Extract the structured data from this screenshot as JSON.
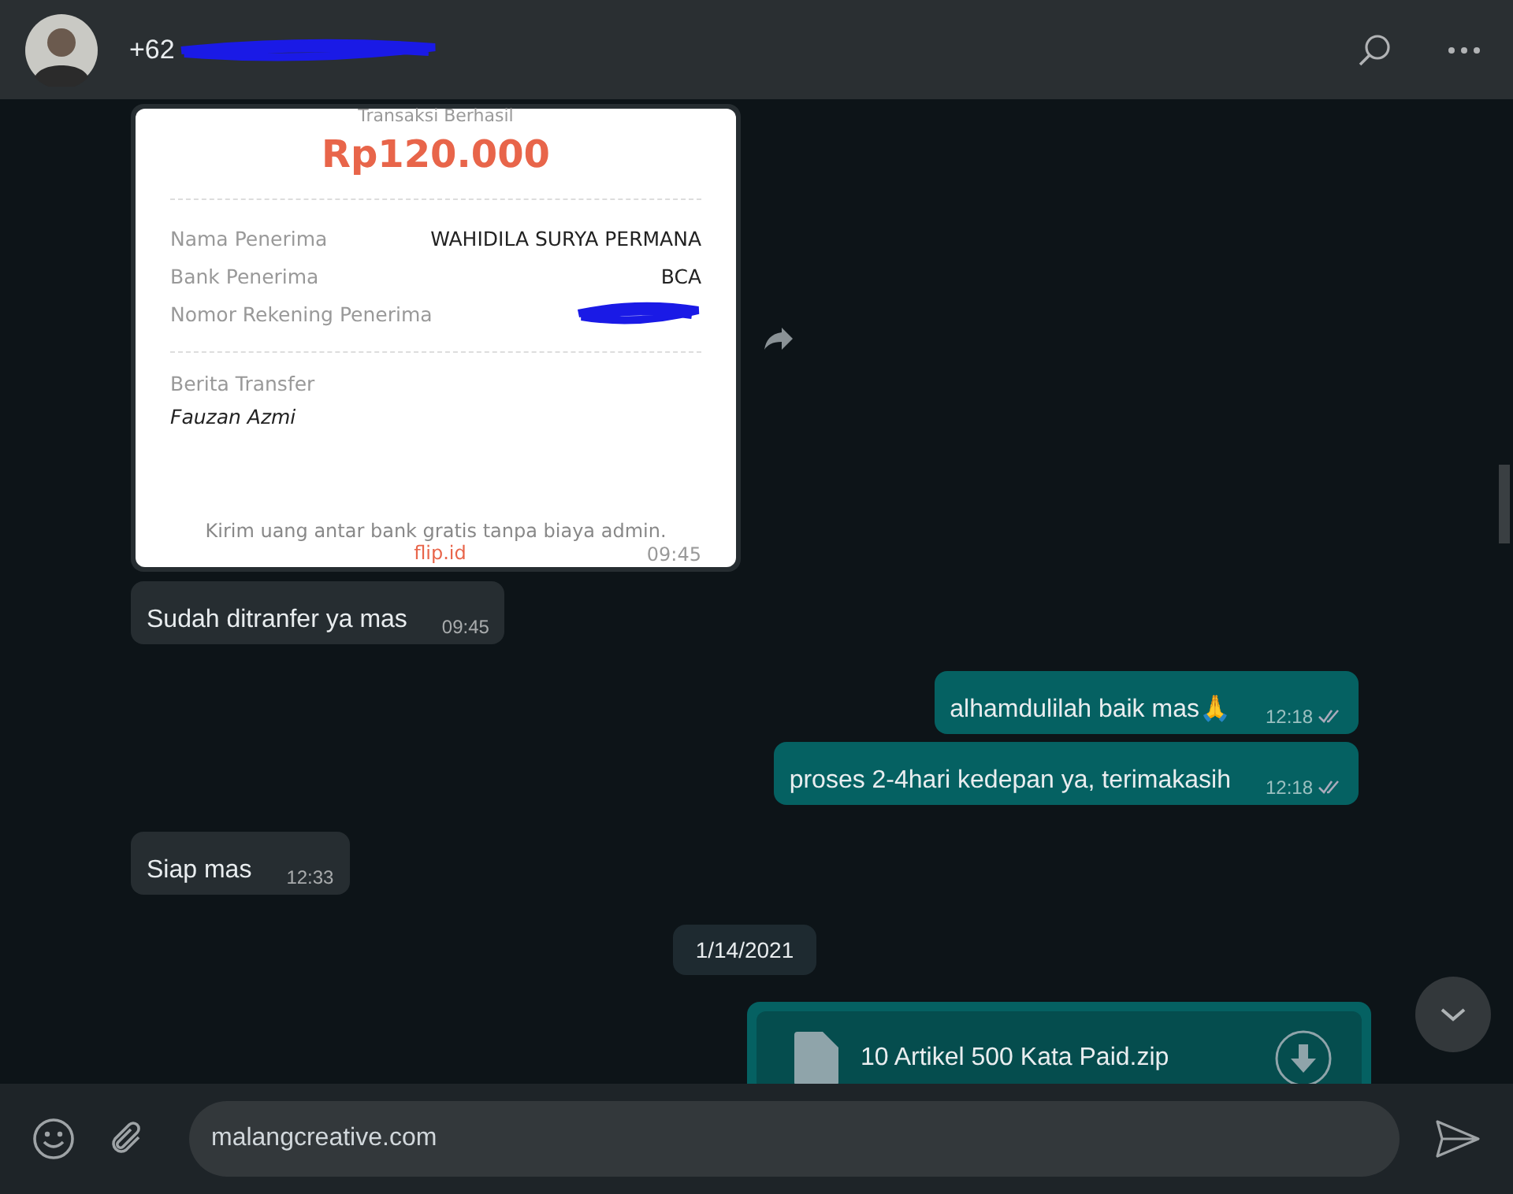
{
  "header": {
    "contact": "+62",
    "redacted": true
  },
  "messages": [
    {
      "kind": "receipt",
      "outgoing": false,
      "status": "Transaksi Berhasil",
      "amount": "Rp120.000",
      "rows": [
        {
          "label": "Nama Penerima",
          "value": "WAHIDILA SURYA PERMANA",
          "redacted": false
        },
        {
          "label": "Bank Penerima",
          "value": "BCA",
          "redacted": false
        },
        {
          "label": "Nomor Rekening Penerima",
          "redacted": true
        }
      ],
      "note_label": "Berita Transfer",
      "note": "Fauzan Azmi",
      "footer": "Kirim uang antar bank gratis tanpa biaya admin.",
      "link": "flip.id",
      "time": "09:45"
    },
    {
      "kind": "text",
      "outgoing": false,
      "text": "Sudah ditranfer ya mas",
      "time": "09:45"
    },
    {
      "kind": "text",
      "outgoing": true,
      "text": "alhamdulilah baik mas🙏",
      "time": "12:18",
      "read": true
    },
    {
      "kind": "text",
      "outgoing": true,
      "text": "proses 2-4hari kedepan ya, terimakasih",
      "time": "12:18",
      "read": true
    },
    {
      "kind": "text",
      "outgoing": false,
      "text": "Siap mas",
      "time": "12:33"
    },
    {
      "kind": "date",
      "text": "1/14/2021"
    },
    {
      "kind": "file",
      "outgoing": true,
      "name": "10 Artikel 500 Kata Paid.zip"
    }
  ],
  "compose": {
    "value": "malangcreative.com"
  }
}
